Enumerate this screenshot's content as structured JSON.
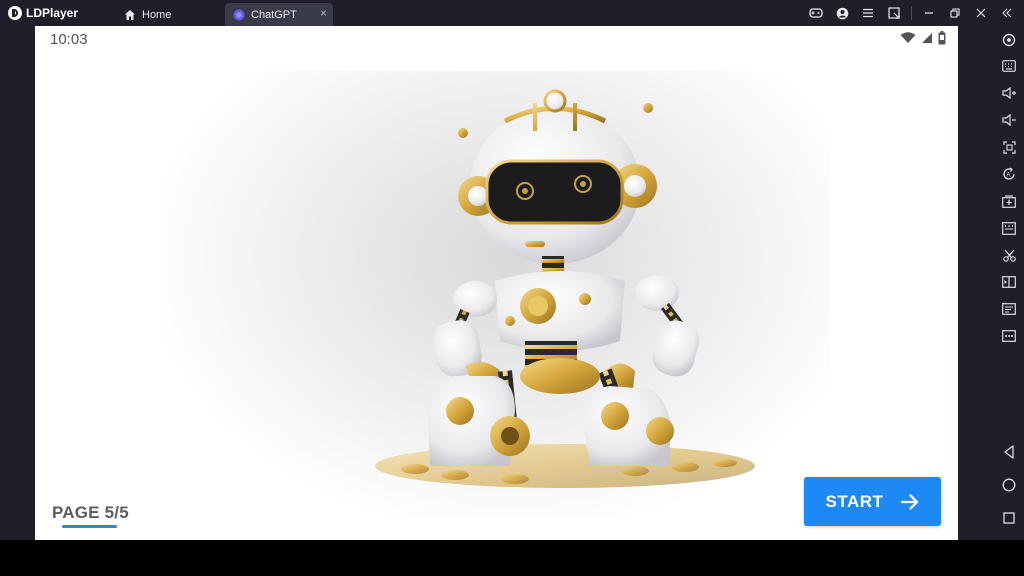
{
  "app": {
    "name": "LDPlayer"
  },
  "tabs": [
    {
      "label": "Home",
      "icon": "home-icon",
      "active": false
    },
    {
      "label": "ChatGPT",
      "icon": "app-icon",
      "active": true,
      "close": "×"
    }
  ],
  "window_controls": [
    "gamepad-icon",
    "account-icon",
    "menu-icon",
    "resize-icon",
    "minimize-icon",
    "restore-icon",
    "close-icon",
    "collapse-sidebar-icon"
  ],
  "status_bar": {
    "time": "10:03",
    "icons": [
      "wifi-icon",
      "signal-icon",
      "battery-icon"
    ]
  },
  "onboarding": {
    "image": "robot-illustration",
    "page_indicator": "PAGE 5/5",
    "start_label": "START"
  },
  "sidebar": [
    "settings-icon",
    "keyboard-icon",
    "volume-up-icon",
    "volume-down-icon",
    "screenshot-icon",
    "rotate-icon",
    "install-apk-icon",
    "fps-icon",
    "cut-icon",
    "multi-instance-icon",
    "operation-record-icon",
    "more-icon",
    "back-icon",
    "home-circle-icon",
    "recent-apps-icon"
  ],
  "colors": {
    "accent": "#1c89f5",
    "chrome": "#1e1f2b",
    "tab_active": "#3a3b48"
  }
}
